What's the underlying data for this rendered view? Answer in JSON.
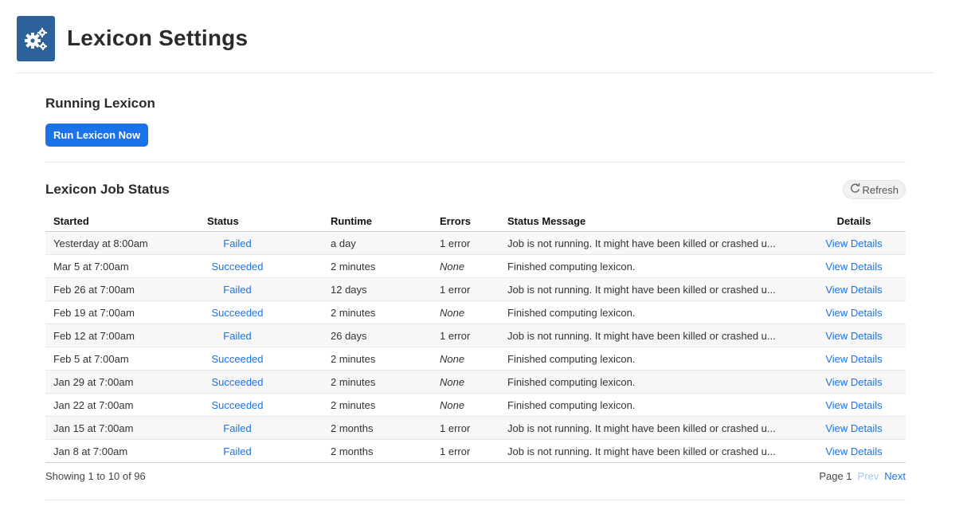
{
  "header": {
    "title": "Lexicon Settings",
    "icon": "gears-icon",
    "icon_color": "#2d6199"
  },
  "running": {
    "title": "Running Lexicon",
    "run_button_label": "Run Lexicon Now"
  },
  "job_status": {
    "title": "Lexicon Job Status",
    "refresh_label": "Refresh",
    "columns": {
      "started": "Started",
      "status": "Status",
      "runtime": "Runtime",
      "errors": "Errors",
      "message": "Status Message",
      "details": "Details"
    },
    "rows": [
      {
        "started": "Yesterday at 8:00am",
        "status": "Failed",
        "runtime": "a day",
        "errors": "1 error",
        "message": "Job is not running. It might have been killed or crashed u...",
        "details": "View Details"
      },
      {
        "started": "Mar 5 at 7:00am",
        "status": "Succeeded",
        "runtime": "2 minutes",
        "errors": "None",
        "message": "Finished computing lexicon.",
        "details": "View Details"
      },
      {
        "started": "Feb 26 at 7:00am",
        "status": "Failed",
        "runtime": "12 days",
        "errors": "1 error",
        "message": "Job is not running. It might have been killed or crashed u...",
        "details": "View Details"
      },
      {
        "started": "Feb 19 at 7:00am",
        "status": "Succeeded",
        "runtime": "2 minutes",
        "errors": "None",
        "message": "Finished computing lexicon.",
        "details": "View Details"
      },
      {
        "started": "Feb 12 at 7:00am",
        "status": "Failed",
        "runtime": "26 days",
        "errors": "1 error",
        "message": "Job is not running. It might have been killed or crashed u...",
        "details": "View Details"
      },
      {
        "started": "Feb 5 at 7:00am",
        "status": "Succeeded",
        "runtime": "2 minutes",
        "errors": "None",
        "message": "Finished computing lexicon.",
        "details": "View Details"
      },
      {
        "started": "Jan 29 at 7:00am",
        "status": "Succeeded",
        "runtime": "2 minutes",
        "errors": "None",
        "message": "Finished computing lexicon.",
        "details": "View Details"
      },
      {
        "started": "Jan 22 at 7:00am",
        "status": "Succeeded",
        "runtime": "2 minutes",
        "errors": "None",
        "message": "Finished computing lexicon.",
        "details": "View Details"
      },
      {
        "started": "Jan 15 at 7:00am",
        "status": "Failed",
        "runtime": "2 months",
        "errors": "1 error",
        "message": "Job is not running. It might have been killed or crashed u...",
        "details": "View Details"
      },
      {
        "started": "Jan 8 at 7:00am",
        "status": "Failed",
        "runtime": "2 months",
        "errors": "1 error",
        "message": "Job is not running. It might have been killed or crashed u...",
        "details": "View Details"
      }
    ],
    "footer": {
      "showing": "Showing 1 to 10 of 96",
      "page": "Page 1",
      "prev": "Prev",
      "next": "Next"
    }
  },
  "colors": {
    "primary": "#1a73e8",
    "link": "#1a73e8"
  }
}
